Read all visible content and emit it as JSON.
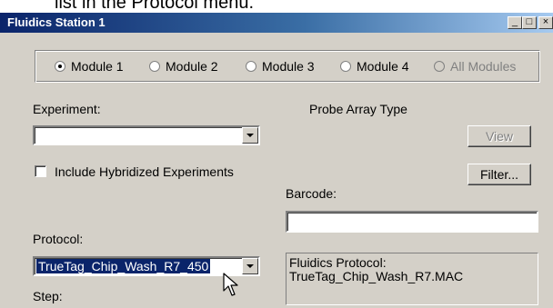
{
  "caption": "list in the Protocol menu.",
  "window": {
    "title": "Fluidics Station 1",
    "minimize": "_",
    "maximize": "□",
    "close": "×"
  },
  "modules": [
    {
      "label": "Module 1",
      "selected": true,
      "enabled": true
    },
    {
      "label": "Module 2",
      "selected": false,
      "enabled": true
    },
    {
      "label": "Module 3",
      "selected": false,
      "enabled": true
    },
    {
      "label": "Module 4",
      "selected": false,
      "enabled": true
    },
    {
      "label": "All Modules",
      "selected": false,
      "enabled": false
    }
  ],
  "experiment": {
    "label": "Experiment:",
    "value": ""
  },
  "include_hybridized": {
    "label": "Include Hybridized Experiments",
    "checked": false
  },
  "probe_array": {
    "label": "Probe Array Type"
  },
  "buttons": {
    "view": "View",
    "filter": "Filter..."
  },
  "barcode": {
    "label": "Barcode:",
    "value": ""
  },
  "protocol": {
    "label": "Protocol:",
    "value": "TrueTag_Chip_Wash_R7_450"
  },
  "fluidics_info": {
    "line1": "Fluidics Protocol:",
    "line2": "TrueTag_Chip_Wash_R7.MAC"
  },
  "step": {
    "label": "Step:"
  },
  "colors": {
    "titlebar_start": "#0a246a",
    "titlebar_end": "#a6caf0",
    "face": "#d4d0c8",
    "selection": "#0a246a"
  }
}
